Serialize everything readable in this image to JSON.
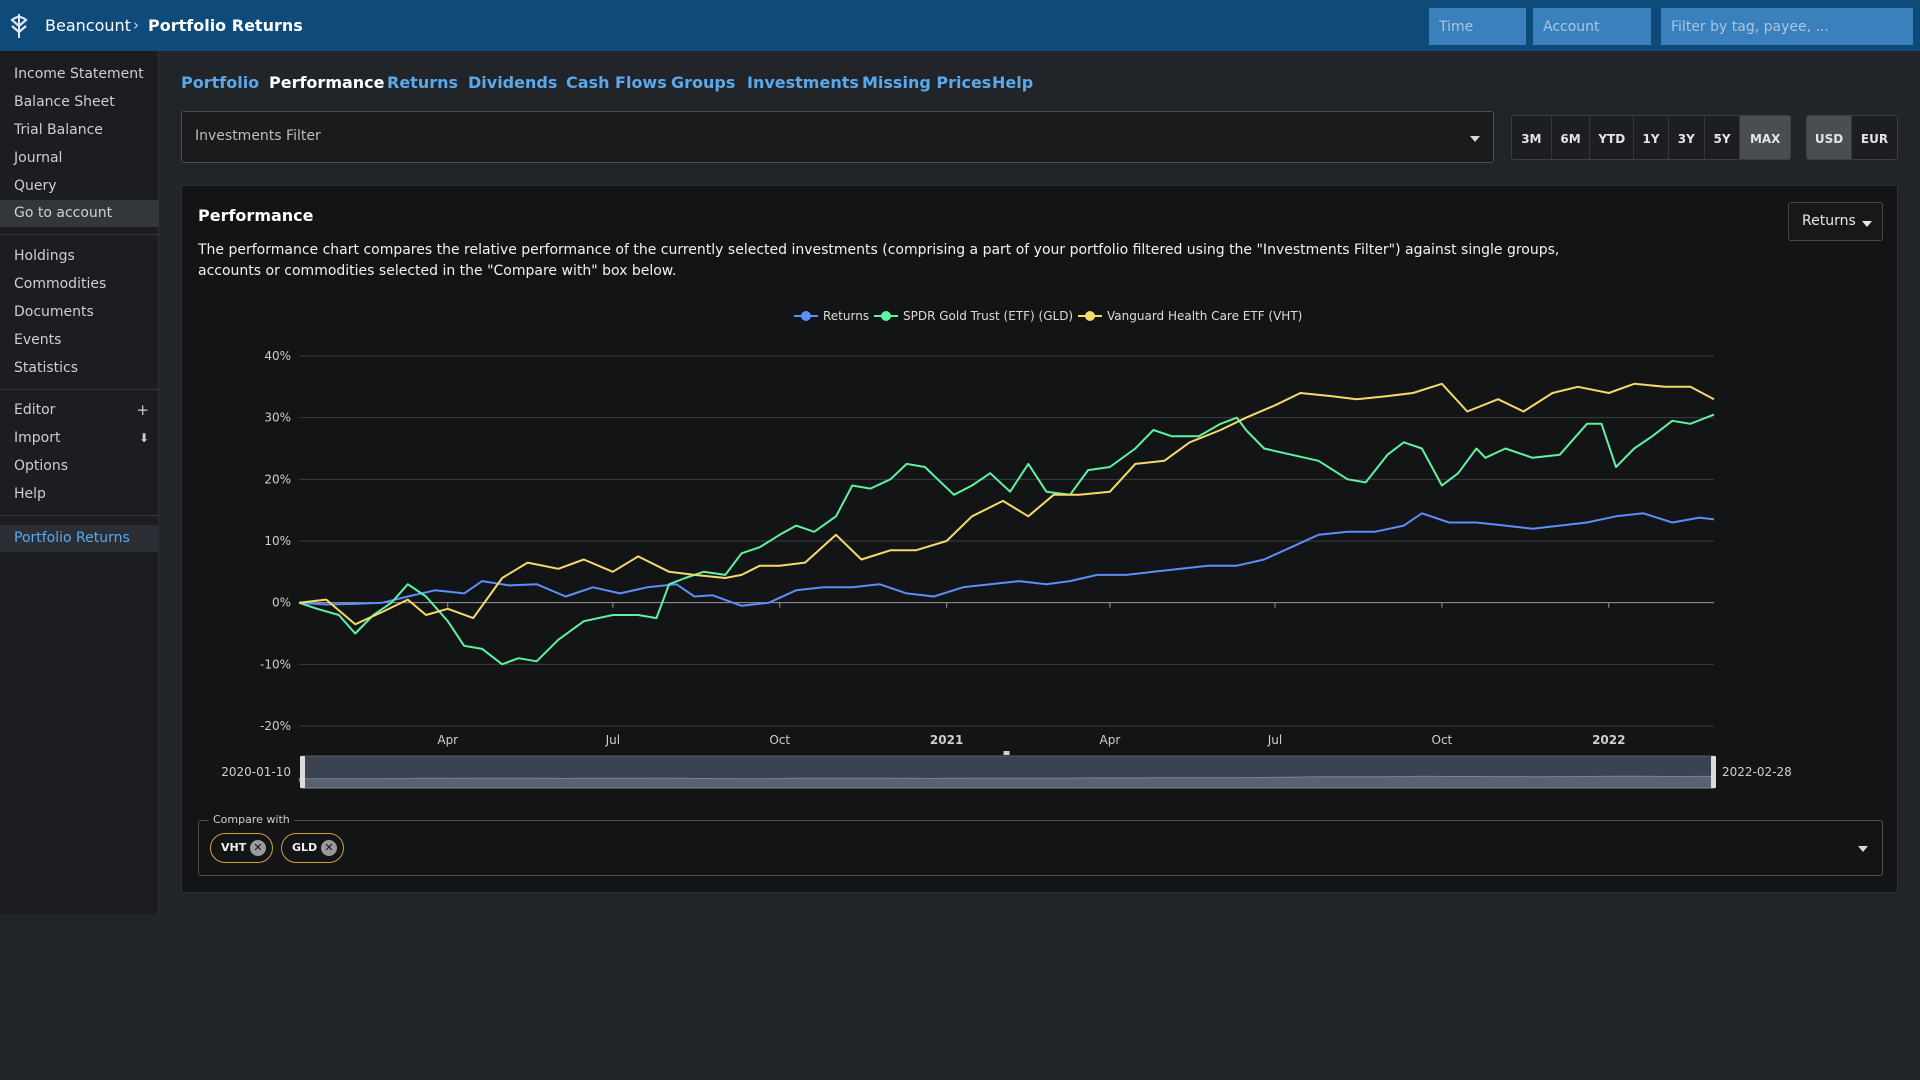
{
  "header": {
    "app_name": "Beancount",
    "separator": "›",
    "page_name": "Portfolio Returns",
    "time_placeholder": "Time",
    "account_placeholder": "Account",
    "filter_placeholder": "Filter by tag, payee, ..."
  },
  "sidebar": {
    "group1": [
      "Income Statement",
      "Balance Sheet",
      "Trial Balance",
      "Journal",
      "Query",
      "Go to account"
    ],
    "group2": [
      "Holdings",
      "Commodities",
      "Documents",
      "Events",
      "Statistics"
    ],
    "group3": [
      "Editor",
      "Import",
      "Options",
      "Help"
    ],
    "editor_icon": "+",
    "import_icon": "⬇",
    "current": "Portfolio Returns"
  },
  "tabs": [
    "Portfolio",
    "Performance",
    "Returns",
    "Dividends",
    "Cash Flows",
    "Groups",
    "Investments",
    "Missing Prices",
    "Help"
  ],
  "filter": {
    "label": "Investments Filter"
  },
  "range_buttons": [
    "3M",
    "6M",
    "YTD",
    "1Y",
    "3Y",
    "5Y",
    "MAX"
  ],
  "range_selected": "MAX",
  "currency_buttons": [
    "USD",
    "EUR"
  ],
  "currency_selected": "USD",
  "panel": {
    "title": "Performance",
    "description": "The performance chart compares the relative performance of the currently selected investments (comprising a part of your portfolio filtered using the \"Investments Filter\") against single groups, accounts or commodities selected in the \"Compare with\" box below.",
    "mode_button": "Returns"
  },
  "compare": {
    "legend": "Compare with",
    "chips": [
      "VHT",
      "GLD"
    ],
    "remove_glyph": "✕"
  },
  "colors": {
    "header": "#0e4a7a",
    "link": "#5aa9ec",
    "returns": "#5b8ff9",
    "gld": "#5ff3a0",
    "vht": "#f6d96b"
  },
  "chart_data": {
    "type": "line",
    "title": "",
    "ylabel": "",
    "xlabel": "",
    "ylim": [
      -20,
      40
    ],
    "y_ticks": [
      "40%",
      "30%",
      "20%",
      "10%",
      "0%",
      "-10%",
      "-20%"
    ],
    "x_ticks": [
      {
        "label": "Apr",
        "date": "2020-04-01",
        "bold": false
      },
      {
        "label": "Jul",
        "date": "2020-07-01",
        "bold": false
      },
      {
        "label": "Oct",
        "date": "2020-10-01",
        "bold": false
      },
      {
        "label": "2021",
        "date": "2021-01-01",
        "bold": true
      },
      {
        "label": "Apr",
        "date": "2021-04-01",
        "bold": false
      },
      {
        "label": "Jul",
        "date": "2021-07-01",
        "bold": false
      },
      {
        "label": "Oct",
        "date": "2021-10-01",
        "bold": false
      },
      {
        "label": "2022",
        "date": "2022-01-01",
        "bold": true
      }
    ],
    "x_range": [
      "2020-01-10",
      "2022-02-28"
    ],
    "zoom_start": "2020-01-10",
    "zoom_end": "2022-02-28",
    "legend_position": "top-center",
    "grid": true,
    "series": [
      {
        "name": "Returns",
        "color": "#5b8ff9",
        "points": [
          [
            "2020-01-10",
            0
          ],
          [
            "2020-01-25",
            -0.3
          ],
          [
            "2020-02-10",
            -0.2
          ],
          [
            "2020-02-25",
            0
          ],
          [
            "2020-03-10",
            1
          ],
          [
            "2020-03-25",
            2
          ],
          [
            "2020-04-10",
            1.5
          ],
          [
            "2020-04-20",
            3.5
          ],
          [
            "2020-05-05",
            2.8
          ],
          [
            "2020-05-20",
            3
          ],
          [
            "2020-06-05",
            1
          ],
          [
            "2020-06-20",
            2.5
          ],
          [
            "2020-07-05",
            1.5
          ],
          [
            "2020-07-20",
            2.5
          ],
          [
            "2020-08-05",
            3
          ],
          [
            "2020-08-15",
            1
          ],
          [
            "2020-08-25",
            1.2
          ],
          [
            "2020-09-10",
            -0.5
          ],
          [
            "2020-09-25",
            0
          ],
          [
            "2020-10-10",
            2
          ],
          [
            "2020-10-25",
            2.5
          ],
          [
            "2020-11-10",
            2.5
          ],
          [
            "2020-11-25",
            3
          ],
          [
            "2020-12-10",
            1.5
          ],
          [
            "2020-12-25",
            1
          ],
          [
            "2021-01-10",
            2.5
          ],
          [
            "2021-01-25",
            3
          ],
          [
            "2021-02-10",
            3.5
          ],
          [
            "2021-02-25",
            3
          ],
          [
            "2021-03-10",
            3.5
          ],
          [
            "2021-03-25",
            4.5
          ],
          [
            "2021-04-10",
            4.5
          ],
          [
            "2021-04-25",
            5
          ],
          [
            "2021-05-10",
            5.5
          ],
          [
            "2021-05-25",
            6
          ],
          [
            "2021-06-10",
            6
          ],
          [
            "2021-06-25",
            7
          ],
          [
            "2021-07-10",
            9
          ],
          [
            "2021-07-25",
            11
          ],
          [
            "2021-08-10",
            11.5
          ],
          [
            "2021-08-25",
            11.5
          ],
          [
            "2021-09-10",
            12.5
          ],
          [
            "2021-09-20",
            14.5
          ],
          [
            "2021-10-05",
            13
          ],
          [
            "2021-10-20",
            13
          ],
          [
            "2021-11-05",
            12.5
          ],
          [
            "2021-11-20",
            12
          ],
          [
            "2021-12-05",
            12.5
          ],
          [
            "2021-12-20",
            13
          ],
          [
            "2022-01-05",
            14
          ],
          [
            "2022-01-20",
            14.5
          ],
          [
            "2022-02-05",
            13
          ],
          [
            "2022-02-20",
            13.8
          ],
          [
            "2022-02-28",
            13.5
          ]
        ]
      },
      {
        "name": "SPDR Gold Trust (ETF) (GLD)",
        "color": "#5ff3a0",
        "points": [
          [
            "2020-01-10",
            0
          ],
          [
            "2020-01-20",
            -1
          ],
          [
            "2020-02-01",
            -2
          ],
          [
            "2020-02-10",
            -5
          ],
          [
            "2020-02-20",
            -2
          ],
          [
            "2020-03-01",
            0
          ],
          [
            "2020-03-10",
            3
          ],
          [
            "2020-03-20",
            1
          ],
          [
            "2020-04-01",
            -3
          ],
          [
            "2020-04-10",
            -7
          ],
          [
            "2020-04-20",
            -7.5
          ],
          [
            "2020-05-01",
            -10
          ],
          [
            "2020-05-10",
            -9
          ],
          [
            "2020-05-20",
            -9.5
          ],
          [
            "2020-06-01",
            -6
          ],
          [
            "2020-06-15",
            -3
          ],
          [
            "2020-07-01",
            -2
          ],
          [
            "2020-07-15",
            -2
          ],
          [
            "2020-07-25",
            -2.5
          ],
          [
            "2020-08-01",
            3
          ],
          [
            "2020-08-10",
            4
          ],
          [
            "2020-08-20",
            5
          ],
          [
            "2020-09-01",
            4.5
          ],
          [
            "2020-09-10",
            8
          ],
          [
            "2020-09-20",
            9
          ],
          [
            "2020-10-01",
            11
          ],
          [
            "2020-10-10",
            12.5
          ],
          [
            "2020-10-20",
            11.5
          ],
          [
            "2020-11-01",
            14
          ],
          [
            "2020-11-10",
            19
          ],
          [
            "2020-11-20",
            18.5
          ],
          [
            "2020-12-01",
            20
          ],
          [
            "2020-12-10",
            22.5
          ],
          [
            "2020-12-20",
            22
          ],
          [
            "2021-01-05",
            17.5
          ],
          [
            "2021-01-15",
            19
          ],
          [
            "2021-01-25",
            21
          ],
          [
            "2021-02-05",
            18
          ],
          [
            "2021-02-15",
            22.5
          ],
          [
            "2021-02-25",
            18
          ],
          [
            "2021-03-10",
            17.5
          ],
          [
            "2021-03-20",
            21.5
          ],
          [
            "2021-04-01",
            22
          ],
          [
            "2021-04-15",
            25
          ],
          [
            "2021-04-25",
            28
          ],
          [
            "2021-05-05",
            27
          ],
          [
            "2021-05-20",
            27
          ],
          [
            "2021-06-01",
            29
          ],
          [
            "2021-06-10",
            30
          ],
          [
            "2021-06-15",
            28
          ],
          [
            "2021-06-25",
            25
          ],
          [
            "2021-07-10",
            24
          ],
          [
            "2021-07-25",
            23
          ],
          [
            "2021-08-10",
            20
          ],
          [
            "2021-08-20",
            19.5
          ],
          [
            "2021-09-01",
            24
          ],
          [
            "2021-09-10",
            26
          ],
          [
            "2021-09-20",
            25
          ],
          [
            "2021-10-01",
            19
          ],
          [
            "2021-10-10",
            21
          ],
          [
            "2021-10-20",
            25
          ],
          [
            "2021-10-25",
            23.5
          ],
          [
            "2021-11-05",
            25
          ],
          [
            "2021-11-20",
            23.5
          ],
          [
            "2021-12-05",
            24
          ],
          [
            "2021-12-20",
            29
          ],
          [
            "2021-12-28",
            29
          ],
          [
            "2022-01-05",
            22
          ],
          [
            "2022-01-15",
            25
          ],
          [
            "2022-01-25",
            27
          ],
          [
            "2022-02-05",
            29.5
          ],
          [
            "2022-02-15",
            29
          ],
          [
            "2022-02-28",
            30.5
          ]
        ]
      },
      {
        "name": "Vanguard Health Care ETF (VHT)",
        "color": "#f6d96b",
        "points": [
          [
            "2020-01-10",
            0
          ],
          [
            "2020-01-25",
            0.5
          ],
          [
            "2020-02-10",
            -3.5
          ],
          [
            "2020-02-25",
            -1.5
          ],
          [
            "2020-03-10",
            0.5
          ],
          [
            "2020-03-20",
            -2
          ],
          [
            "2020-04-01",
            -1
          ],
          [
            "2020-04-15",
            -2.5
          ],
          [
            "2020-05-01",
            4
          ],
          [
            "2020-05-15",
            6.5
          ],
          [
            "2020-06-01",
            5.5
          ],
          [
            "2020-06-15",
            7
          ],
          [
            "2020-07-01",
            5
          ],
          [
            "2020-07-15",
            7.5
          ],
          [
            "2020-08-01",
            5
          ],
          [
            "2020-08-15",
            4.5
          ],
          [
            "2020-09-01",
            4
          ],
          [
            "2020-09-10",
            4.5
          ],
          [
            "2020-09-20",
            6
          ],
          [
            "2020-10-01",
            6
          ],
          [
            "2020-10-15",
            6.5
          ],
          [
            "2020-11-01",
            11
          ],
          [
            "2020-11-15",
            7
          ],
          [
            "2020-12-01",
            8.5
          ],
          [
            "2020-12-15",
            8.5
          ],
          [
            "2021-01-01",
            10
          ],
          [
            "2021-01-15",
            14
          ],
          [
            "2021-02-01",
            16.5
          ],
          [
            "2021-02-15",
            14
          ],
          [
            "2021-03-01",
            17.5
          ],
          [
            "2021-03-15",
            17.5
          ],
          [
            "2021-04-01",
            18
          ],
          [
            "2021-04-15",
            22.5
          ],
          [
            "2021-05-01",
            23
          ],
          [
            "2021-05-15",
            26
          ],
          [
            "2021-06-01",
            28
          ],
          [
            "2021-06-15",
            30
          ],
          [
            "2021-07-01",
            32
          ],
          [
            "2021-07-15",
            34
          ],
          [
            "2021-08-01",
            33.5
          ],
          [
            "2021-08-15",
            33
          ],
          [
            "2021-09-01",
            33.5
          ],
          [
            "2021-09-15",
            34
          ],
          [
            "2021-10-01",
            35.5
          ],
          [
            "2021-10-15",
            31
          ],
          [
            "2021-11-01",
            33
          ],
          [
            "2021-11-15",
            31
          ],
          [
            "2021-12-01",
            34
          ],
          [
            "2021-12-15",
            35
          ],
          [
            "2022-01-01",
            34
          ],
          [
            "2022-01-15",
            35.5
          ],
          [
            "2022-02-01",
            35
          ],
          [
            "2022-02-15",
            35
          ],
          [
            "2022-02-28",
            33
          ]
        ]
      }
    ]
  }
}
